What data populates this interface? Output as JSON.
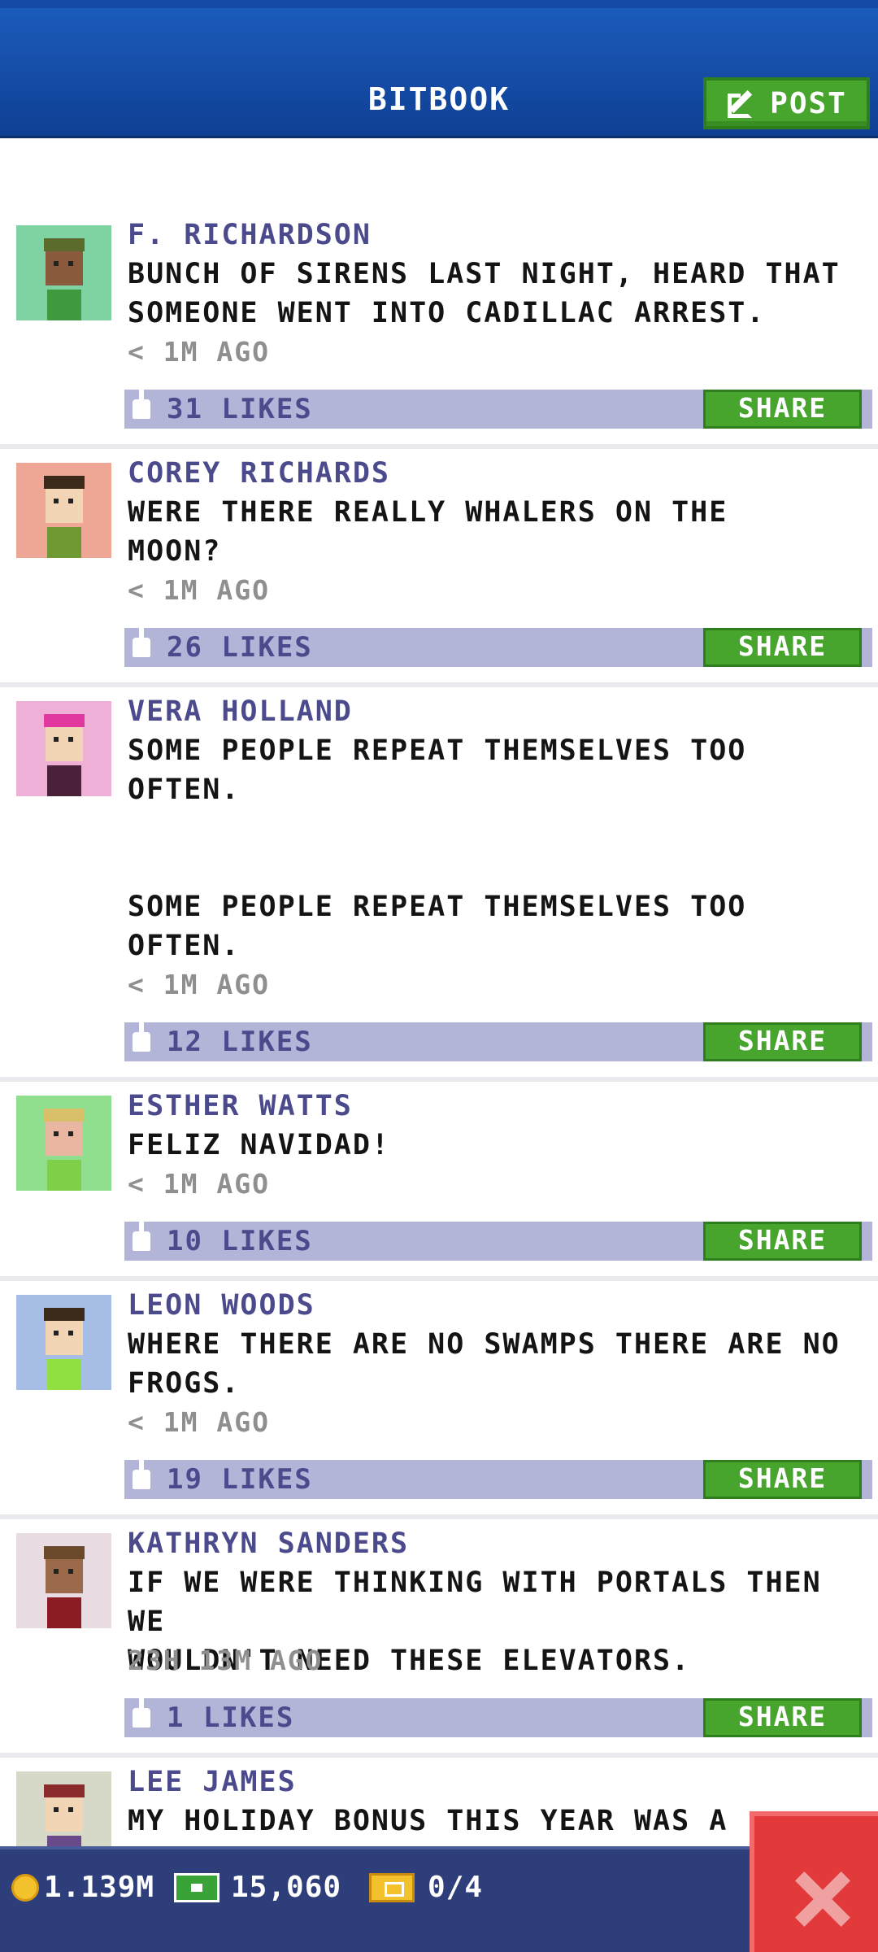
{
  "header": {
    "title": "BITBOOK",
    "post_label": "POST"
  },
  "posts": [
    {
      "author": "F. RICHARDSON",
      "text": "BUNCH OF SIRENS LAST NIGHT, HEARD THAT\nSOMEONE WENT INTO CADILLAC ARREST.",
      "time": "< 1M AGO",
      "likes": "31 LIKES",
      "share": "SHARE",
      "avatar_bg": "#7fd3a3"
    },
    {
      "author": "COREY RICHARDS",
      "text": "WERE THERE REALLY WHALERS ON THE\nMOON?",
      "time": "< 1M AGO",
      "likes": "26 LIKES",
      "share": "SHARE",
      "avatar_bg": "#eda794"
    },
    {
      "author": "VERA HOLLAND",
      "text": "SOME PEOPLE REPEAT THEMSELVES TOO\nOFTEN.\n\n\nSOME PEOPLE REPEAT THEMSELVES TOO\nOFTEN.",
      "time": "< 1M AGO",
      "likes": "12 LIKES",
      "share": "SHARE",
      "avatar_bg": "#eeb0d7"
    },
    {
      "author": "ESTHER WATTS",
      "text": "FELIZ NAVIDAD!",
      "time": "< 1M AGO",
      "likes": "10 LIKES",
      "share": "SHARE",
      "avatar_bg": "#8fdf8f"
    },
    {
      "author": "LEON WOODS",
      "text": "WHERE THERE ARE NO SWAMPS THERE ARE NO\nFROGS.",
      "time": "< 1M AGO",
      "likes": "19 LIKES",
      "share": "SHARE",
      "avatar_bg": "#a6bde6"
    },
    {
      "author": "KATHRYN SANDERS",
      "text": "IF WE WERE THINKING WITH PORTALS THEN WE\nWOULDN'T NEED THESE ELEVATORS.",
      "time": "23H 13M AGO",
      "likes": "1 LIKES",
      "share": "SHARE",
      "avatar_bg": "#e8dbe2"
    },
    {
      "author": "LEE JAMES",
      "text": "MY HOLIDAY BONUS THIS YEAR WAS A",
      "avatar_bg": "#d6d8c8"
    }
  ],
  "status_bar": {
    "coins": "1.139M",
    "bux": "15,060",
    "tickets": "0/4"
  }
}
